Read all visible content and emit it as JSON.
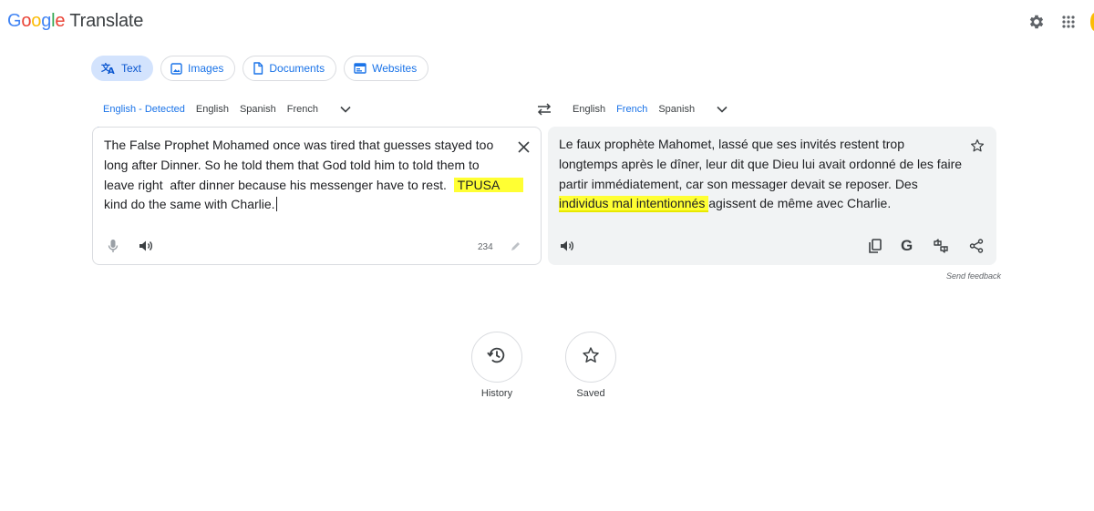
{
  "header": {
    "logo_letters": [
      "G",
      "o",
      "o",
      "g",
      "l",
      "e"
    ],
    "logo_suffix": "Translate",
    "settings_icon": "gear-icon",
    "apps_icon": "apps-grid-icon"
  },
  "mode_tabs": [
    {
      "label": "Text",
      "icon": "translate-icon",
      "active": true
    },
    {
      "label": "Images",
      "icon": "image-icon",
      "active": false
    },
    {
      "label": "Documents",
      "icon": "document-icon",
      "active": false
    },
    {
      "label": "Websites",
      "icon": "website-icon",
      "active": false
    }
  ],
  "source_langs": [
    {
      "label": "English - Detected",
      "active": true
    },
    {
      "label": "English",
      "active": false
    },
    {
      "label": "Spanish",
      "active": false
    },
    {
      "label": "French",
      "active": false
    }
  ],
  "target_langs": [
    {
      "label": "English",
      "active": false
    },
    {
      "label": "French",
      "active": true
    },
    {
      "label": "Spanish",
      "active": false
    }
  ],
  "source": {
    "lines": [
      "The False Prophet Mohamed once was tired that guesses stayed too",
      "long after Dinner. So he told them that God told him to told them to",
      "leave right  after dinner because his messenger have to rest.  ",
      "kind do the same with Charlie."
    ],
    "highlight": "TPUSA",
    "char_count": "234"
  },
  "target": {
    "lines": [
      "Le faux prophète Mahomet, lassé que ses invités restent trop",
      "longtemps après le dîner, leur dit que Dieu lui avait ordonné de les faire",
      "partir immédiatement, car son messager devait se reposer. Des",
      "agissent de même avec Charlie."
    ],
    "highlight": "individus mal intentionnés "
  },
  "send_feedback": "Send feedback",
  "bottom": {
    "history_label": "History",
    "saved_label": "Saved"
  },
  "colors": {
    "accent": "#1a73e8",
    "active_tab_bg": "#d3e3fd",
    "highlight": "#ffff33",
    "target_panel_bg": "#f1f3f4"
  }
}
